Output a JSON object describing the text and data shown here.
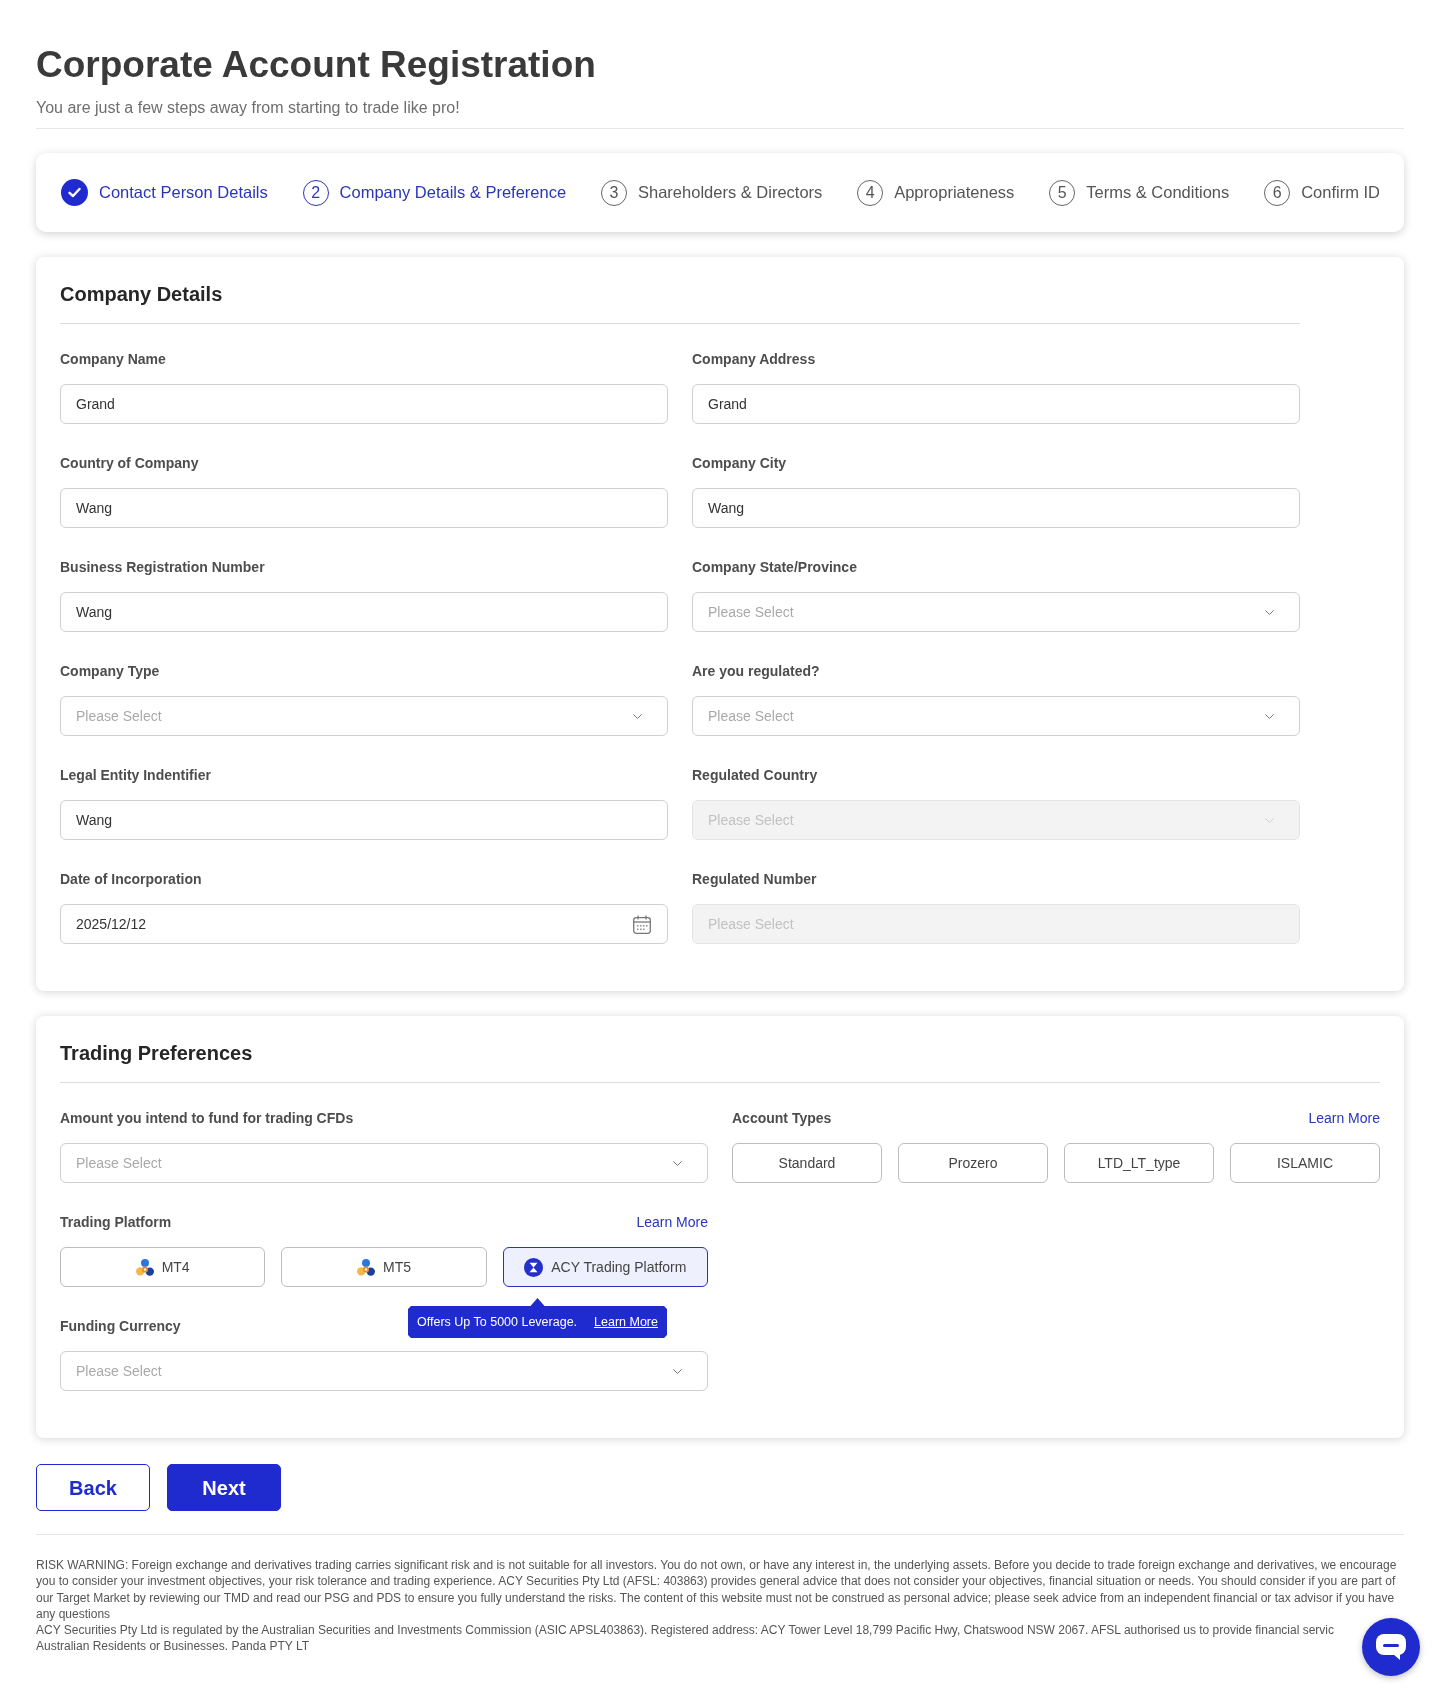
{
  "header": {
    "title": "Corporate Account Registration",
    "subtitle": "You are just a few steps away from starting to trade like pro!"
  },
  "steps": [
    {
      "label": "Contact Person Details",
      "completed": true,
      "selected": false
    },
    {
      "number": "2",
      "label": "Company Details & Preference",
      "completed": false,
      "selected": true
    },
    {
      "number": "3",
      "label": "Shareholders & Directors",
      "completed": false,
      "selected": false
    },
    {
      "number": "4",
      "label": "Appropriateness",
      "completed": false,
      "selected": false
    },
    {
      "number": "5",
      "label": "Terms & Conditions",
      "completed": false,
      "selected": false
    },
    {
      "number": "6",
      "label": "Confirm ID",
      "completed": false,
      "selected": false
    }
  ],
  "company_details": {
    "title": "Company Details",
    "fields": [
      {
        "label": "Company Name",
        "kind": "text",
        "value": "Grand",
        "disabled": false
      },
      {
        "label": "Company Address",
        "kind": "text",
        "value": "Grand",
        "disabled": false
      },
      {
        "label": "Country of Company",
        "kind": "text",
        "value": "Wang",
        "disabled": false
      },
      {
        "label": "Company City",
        "kind": "text",
        "value": "Wang",
        "disabled": false
      },
      {
        "label": "Business Registration Number",
        "kind": "text",
        "value": "Wang",
        "disabled": false
      },
      {
        "label": "Company State/Province",
        "kind": "select",
        "placeholder": "Please Select",
        "disabled": false
      },
      {
        "label": "Company Type",
        "kind": "select",
        "placeholder": "Please Select",
        "disabled": false
      },
      {
        "label": "Are you regulated?",
        "kind": "select",
        "placeholder": "Please Select",
        "disabled": false
      },
      {
        "label": "Legal Entity Indentifier",
        "kind": "text",
        "value": "Wang",
        "disabled": false
      },
      {
        "label": "Regulated Country",
        "kind": "select",
        "placeholder": "Please Select",
        "disabled": true
      },
      {
        "label": "Date of Incorporation",
        "kind": "date",
        "value": "2025/12/12",
        "disabled": false
      },
      {
        "label": "Regulated Number",
        "kind": "text",
        "placeholder": "Please Select",
        "disabled": true
      }
    ]
  },
  "trading_preferences": {
    "title": "Trading Preferences",
    "fund_amount": {
      "label": "Amount you intend to fund for trading CFDs",
      "placeholder": "Please Select"
    },
    "account_types": {
      "label": "Account Types",
      "link": "Learn More",
      "options": [
        {
          "label": "Standard",
          "selected": false
        },
        {
          "label": "Prozero",
          "selected": false
        },
        {
          "label": "LTD_LT_type",
          "selected": false
        },
        {
          "label": "ISLAMIC",
          "selected": false
        }
      ]
    },
    "trading_platform": {
      "label": "Trading Platform",
      "link": "Learn More",
      "options": [
        {
          "label": "MT4",
          "kind": "triangle",
          "selected": false
        },
        {
          "label": "MT5",
          "kind": "triangle",
          "selected": false
        },
        {
          "label": "ACY Trading Platform",
          "kind": "hourglass",
          "selected": true
        }
      ],
      "tooltip": {
        "text": "Offers Up To 5000 Leverage.",
        "link": "Learn More"
      }
    },
    "funding_currency": {
      "label": "Funding Currency",
      "placeholder": "Please Select"
    }
  },
  "actions": [
    {
      "label": "Back",
      "kind": "outline"
    },
    {
      "label": "Next",
      "kind": "filled"
    }
  ],
  "footer": {
    "risk_warning": "RISK WARNING: Foreign exchange and derivatives trading carries significant risk and is not suitable for all investors. You do not own, or have any interest in, the underlying assets. Before you decide to trade foreign exchange and derivatives, we encourage you to consider your investment objectives, your risk tolerance and trading experience. ACY Securities Pty Ltd (AFSL: 403863) provides general advice that does not consider your objectives, financial situation or needs. You should consider if you are part of our Target Market by reviewing our TMD and read our PSG and PDS to ensure you fully understand the risks. The content of this website must not be construed as personal advice; please seek advice from an independent financial or tax advisor if you have any questions",
    "regulation": [
      "ACY Securities Pty Ltd is regulated by the Australian Securities and Investments Commission (ASIC APSL403863). Registered address: ACY Tower Level 18,799 Pacific Hwy, Chatswood NSW 2067. AFSL authorised us to provide financial servic",
      "Australian Residents or Businesses. Panda PTY LT"
    ]
  }
}
